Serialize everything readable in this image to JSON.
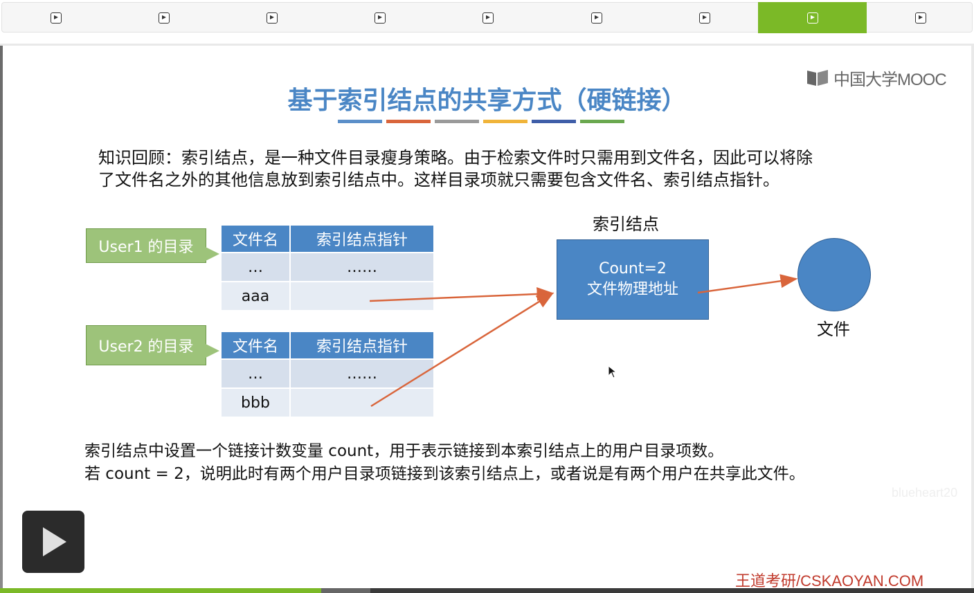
{
  "tabs": [
    {
      "label": "",
      "active": false
    },
    {
      "label": "",
      "active": false
    },
    {
      "label": "",
      "active": false
    },
    {
      "label": "",
      "active": false
    },
    {
      "label": "",
      "active": false
    },
    {
      "label": "",
      "active": false
    },
    {
      "label": "",
      "active": false
    },
    {
      "label": "",
      "active": true
    },
    {
      "label": "",
      "active": false
    }
  ],
  "logo": {
    "text": "中国大学MOOC"
  },
  "slide": {
    "title": "基于索引结点的共享方式（硬链接）",
    "title_bar_colors": [
      "#5b8fc9",
      "#d9653b",
      "#9a9a9a",
      "#f0b43a",
      "#3f5ea8",
      "#6aa84f"
    ],
    "intro_line1": "知识回顾：索引结点，是一种文件目录瘦身策略。由于检索文件时只需用到文件名，因此可以将除",
    "intro_line2": "了文件名之外的其他信息放到索引结点中。这样目录项就只需要包含文件名、索引结点指针。",
    "user1_label": "User1 的目录",
    "user2_label": "User2 的目录",
    "table_headers": [
      "文件名",
      "索引结点指针"
    ],
    "user1_rows": [
      [
        "…",
        "……"
      ],
      [
        "aaa",
        ""
      ]
    ],
    "user2_rows": [
      [
        "…",
        "……"
      ],
      [
        "bbb",
        ""
      ]
    ],
    "inode_title": "索引结点",
    "inode_count": "Count=2",
    "inode_addr": "文件物理地址",
    "file_label": "文件",
    "bottom_line1": "索引结点中设置一个链接计数变量 count，用于表示链接到本索引结点上的用户目录项数。",
    "bottom_line2": "若 count = 2，说明此时有两个用户目录项链接到该索引结点上，或者说是有两个用户在共享此文件。",
    "watermark": "blueheart20",
    "brand": "王道考研/CSKAOYAN.COM"
  },
  "player": {
    "progress": 0.33,
    "buffered": 0.38
  },
  "colors": {
    "accent": "#7bb927",
    "diagram_blue": "#4a86c5",
    "callout_green": "#9dc37a",
    "arrow": "#d9653b"
  }
}
